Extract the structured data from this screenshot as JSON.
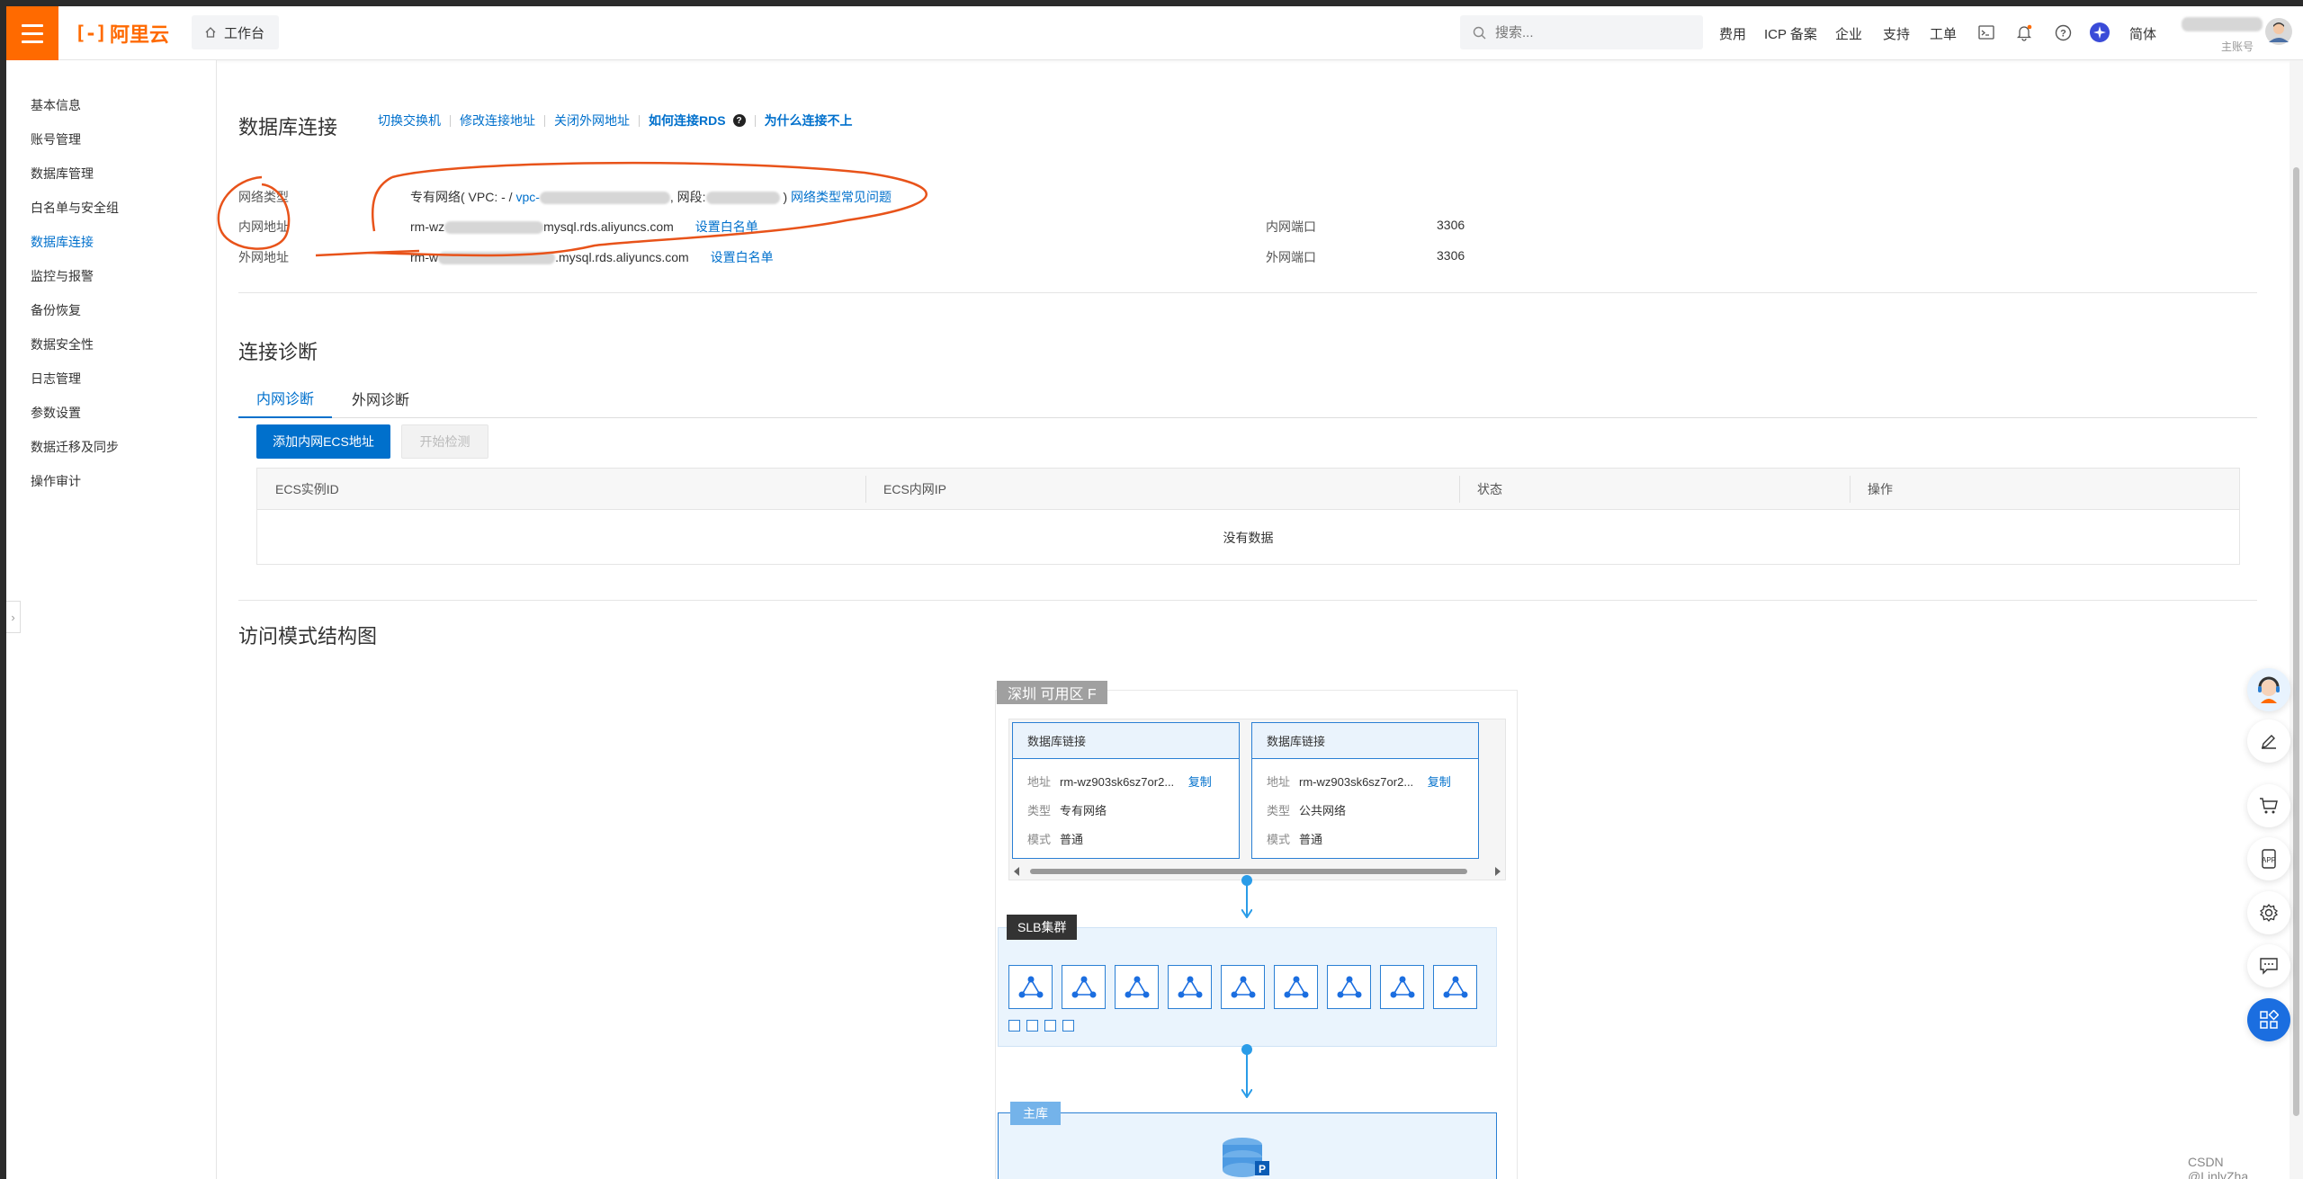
{
  "header": {
    "logo_text": "阿里云",
    "workbench_label": "工作台",
    "search_placeholder": "搜索...",
    "nav": [
      "费用",
      "ICP 备案",
      "企业",
      "支持",
      "工单"
    ],
    "lang_label": "简体",
    "account_sub": "主账号",
    "accent_color": "#ff6a00"
  },
  "sidebar": {
    "items": [
      {
        "label": "基本信息"
      },
      {
        "label": "账号管理"
      },
      {
        "label": "数据库管理"
      },
      {
        "label": "白名单与安全组"
      },
      {
        "label": "数据库连接",
        "active": true
      },
      {
        "label": "监控与报警"
      },
      {
        "label": "备份恢复"
      },
      {
        "label": "数据安全性"
      },
      {
        "label": "日志管理"
      },
      {
        "label": "参数设置"
      },
      {
        "label": "数据迁移及同步"
      },
      {
        "label": "操作审计"
      }
    ]
  },
  "connection": {
    "title": "数据库连接",
    "links": [
      "切换交换机",
      "修改连接地址",
      "关闭外网地址"
    ],
    "bold_links": [
      "如何连接RDS",
      "为什么连接不上"
    ],
    "network_type_label": "网络类型",
    "network_type_prefix": "专有网络( VPC: - / ",
    "vpc_link": "vpc-",
    "segment_label": ", 网段:",
    "network_type_close": " )",
    "network_faq_link": "网络类型常见问题",
    "internal_addr_label": "内网地址",
    "internal_addr_prefix": "rm-wz",
    "internal_addr_suffix": "mysql.rds.aliyuncs.com",
    "internal_whitelist": "设置白名单",
    "internal_port_label": "内网端口",
    "internal_port": "3306",
    "external_addr_label": "外网地址",
    "external_addr_prefix": "rm-w",
    "external_addr_suffix": ".mysql.rds.aliyuncs.com",
    "external_whitelist": "设置白名单",
    "external_port_label": "外网端口",
    "external_port": "3306",
    "annotation_color": "#e8531a"
  },
  "diagnosis": {
    "title": "连接诊断",
    "tabs": [
      "内网诊断",
      "外网诊断"
    ],
    "add_button": "添加内网ECS地址",
    "start_button": "开始检测",
    "columns": [
      "ECS实例ID",
      "ECS内网IP",
      "状态",
      "操作"
    ],
    "empty_text": "没有数据"
  },
  "structure": {
    "title": "访问模式结构图",
    "zone_label": "深圳 可用区 F",
    "cards": [
      {
        "title": "数据库链接",
        "addr_key": "地址",
        "addr": "rm-wz903sk6sz7or2...",
        "copy": "复制",
        "type_key": "类型",
        "type": "专有网络",
        "mode_key": "模式",
        "mode": "普通"
      },
      {
        "title": "数据库链接",
        "addr_key": "地址",
        "addr": "rm-wz903sk6sz7or2...",
        "copy": "复制",
        "type_key": "类型",
        "type": "公共网络",
        "mode_key": "模式",
        "mode": "普通"
      }
    ],
    "slb_label": "SLB集群",
    "slb_node_count": 9,
    "slb_square_count": 4,
    "master_label": "主库",
    "master_badge": "P"
  },
  "watermark": "CSDN @LinlyZha"
}
